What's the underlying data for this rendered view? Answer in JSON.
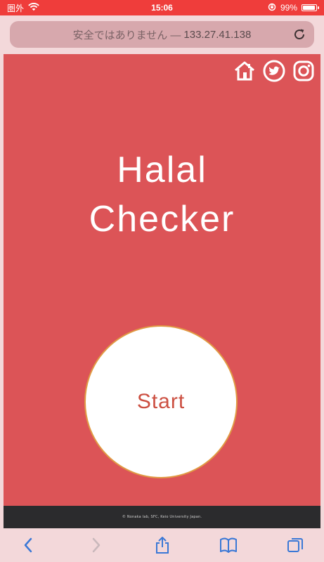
{
  "status_bar": {
    "carrier": "圏外",
    "time": "15:06",
    "battery": "99%",
    "battery_level": 0.99
  },
  "address_bar": {
    "insecure_label": "安全ではありません —",
    "host": "133.27.41.138"
  },
  "page": {
    "title_line_1": "Halal",
    "title_line_2": "Checker",
    "start_button_label": "Start",
    "footer_text": "© Nonaka lab, SFC, Keio University Japan."
  },
  "colors": {
    "status_bar": "#ef3d3b",
    "page_background": "#dc5457",
    "browser_chrome": "#f3d8da",
    "button_text": "#cc4f41",
    "button_border": "#e09a44"
  },
  "icons": {
    "home": "home-icon",
    "twitter": "twitter-icon",
    "instagram": "instagram-icon",
    "reload": "reload-icon",
    "back": "back-icon",
    "forward": "forward-icon",
    "share": "share-icon",
    "bookmarks": "bookmarks-icon",
    "tabs": "tabs-icon"
  }
}
